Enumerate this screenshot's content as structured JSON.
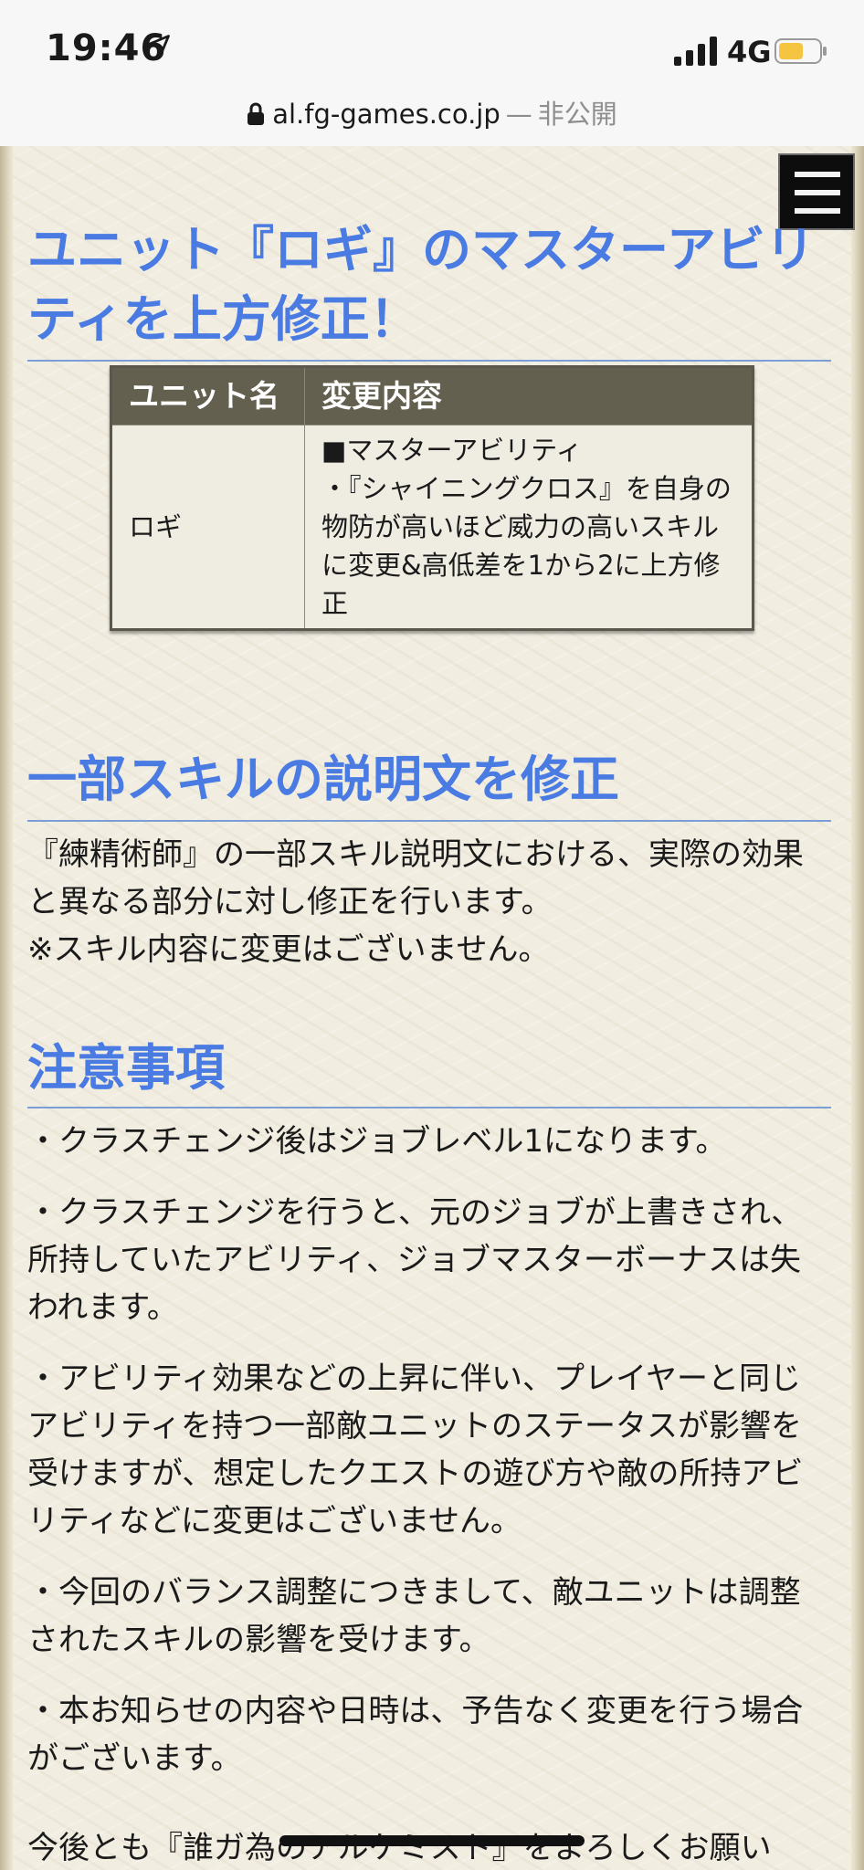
{
  "status_bar": {
    "time": "19:46",
    "network": "4G",
    "location_icon": "location-arrow-icon",
    "signal_icon": "cellular-signal-icon",
    "battery_icon": "battery-low-icon",
    "battery_color": "#f5c542"
  },
  "url_bar": {
    "lock_icon": "lock-icon",
    "domain": "al.fg-games.co.jp",
    "separator": "—",
    "privacy_label": "非公開"
  },
  "page": {
    "menu_icon": "hamburger-menu-icon",
    "heading_loki": "ユニット『ロギ』のマスターアビリティを上方修正！",
    "table": {
      "headers": [
        "ユニット名",
        "変更内容"
      ],
      "rows": [
        {
          "unit": "ロギ",
          "change_lines": [
            "■マスターアビリティ",
            "・『シャイニングクロス』を自身の物防が高いほど威力の高いスキルに変更&高低差を1から2に上方修正"
          ]
        }
      ]
    },
    "heading_skill": "一部スキルの説明文を修正",
    "skill_text": "『練精術師』の一部スキル説明文における、実際の効果と異なる部分に対し修正を行います。",
    "skill_note": "※スキル内容に変更はございません。",
    "heading_notes": "注意事項",
    "notes": [
      "・クラスチェンジ後はジョブレベル1になります。",
      "・クラスチェンジを行うと、元のジョブが上書きされ、所持していたアビリティ、ジョブマスターボーナスは失われます。",
      "・アビリティ効果などの上昇に伴い、プレイヤーと同じアビリティを持つ一部敵ユニットのステータスが影響を受けますが、想定したクエストの遊び方や敵の所持アビリティなどに変更はございません。",
      "・今回のバランス調整につきまして、敵ユニットは調整されたスキルの影響を受けます。",
      "・本お知らせの内容や日時は、予告なく変更を行う場合がございます。"
    ],
    "closing": "今後とも『誰ガ為のアルケミスト』をよろしくお願い"
  }
}
